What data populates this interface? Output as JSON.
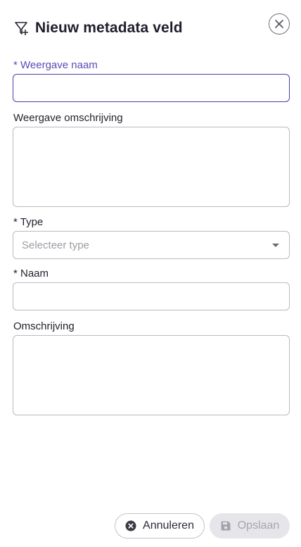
{
  "dialog": {
    "title": "Nieuw metadata veld",
    "header_icon": "filter-add-icon",
    "close_icon": "close-icon"
  },
  "fields": {
    "display_name": {
      "label": "* Weergave naam",
      "value": ""
    },
    "display_description": {
      "label": "Weergave omschrijving",
      "value": ""
    },
    "type": {
      "label": "* Type",
      "placeholder": "Selecteer type"
    },
    "name": {
      "label": "* Naam",
      "value": ""
    },
    "description": {
      "label": "Omschrijving",
      "value": ""
    }
  },
  "footer": {
    "cancel_label": "Annuleren",
    "cancel_icon": "cancel-circle-icon",
    "save_label": "Opslaan",
    "save_icon": "save-icon"
  },
  "colors": {
    "accent": "#5b4bb7",
    "focus_border": "#4c3ca8",
    "disabled_bg": "#e6e6ea"
  }
}
